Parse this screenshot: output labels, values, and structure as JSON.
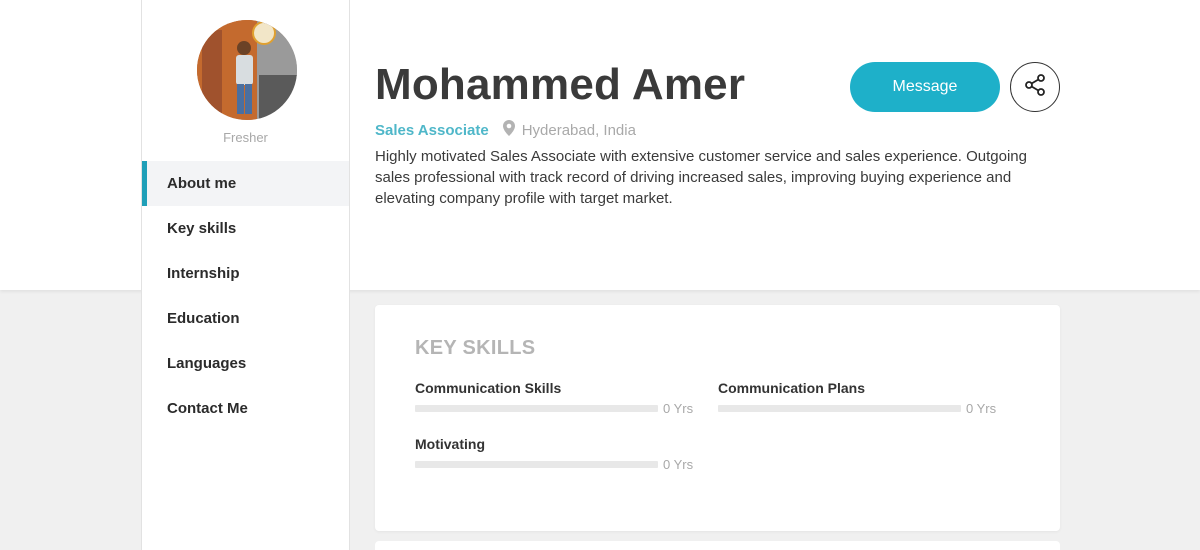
{
  "profile": {
    "name": "Mohammed Amer",
    "status": "Fresher",
    "role": "Sales Associate",
    "location": "Hyderabad, India",
    "bio": "Highly motivated Sales Associate with extensive customer service and sales experience. Outgoing sales professional with track record of driving increased sales, improving buying experience and elevating company profile with target market."
  },
  "actions": {
    "message_label": "Message",
    "share_icon": "share-icon"
  },
  "nav": {
    "active_index": 0,
    "items": [
      {
        "label": "About me"
      },
      {
        "label": "Key skills"
      },
      {
        "label": "Internship"
      },
      {
        "label": "Education"
      },
      {
        "label": "Languages"
      },
      {
        "label": "Contact Me"
      }
    ]
  },
  "key_skills": {
    "title": "KEY SKILLS",
    "skills": [
      {
        "name": "Communication Skills",
        "years": "0 Yrs",
        "level": 0
      },
      {
        "name": "Communication Plans",
        "years": "0 Yrs",
        "level": 0
      },
      {
        "name": "Motivating",
        "years": "0 Yrs",
        "level": 0
      }
    ]
  },
  "colors": {
    "accent": "#1eb0c9",
    "role_text": "#4fb7c9",
    "page_bg": "#f0f0f0"
  },
  "icons": {
    "location": "map-pin-icon",
    "share": "share-icon"
  }
}
